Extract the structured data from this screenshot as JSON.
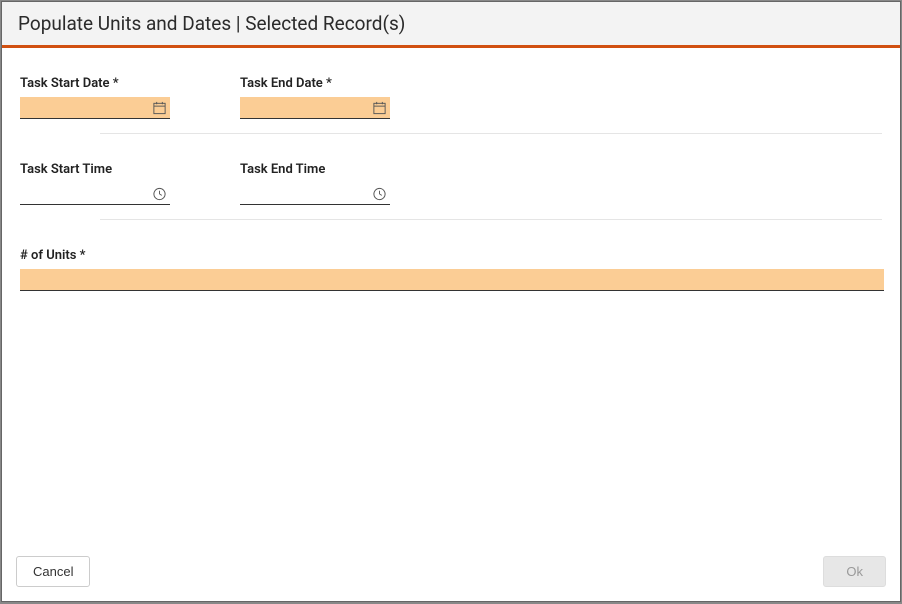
{
  "header": {
    "title": "Populate Units and Dates | Selected Record(s)"
  },
  "fields": {
    "taskStartDate": {
      "label": "Task Start Date *",
      "value": ""
    },
    "taskEndDate": {
      "label": "Task End Date *",
      "value": ""
    },
    "taskStartTime": {
      "label": "Task Start Time",
      "value": ""
    },
    "taskEndTime": {
      "label": "Task End Time",
      "value": ""
    },
    "numUnits": {
      "label": "# of Units *",
      "value": ""
    }
  },
  "footer": {
    "cancel": "Cancel",
    "ok": "Ok"
  }
}
